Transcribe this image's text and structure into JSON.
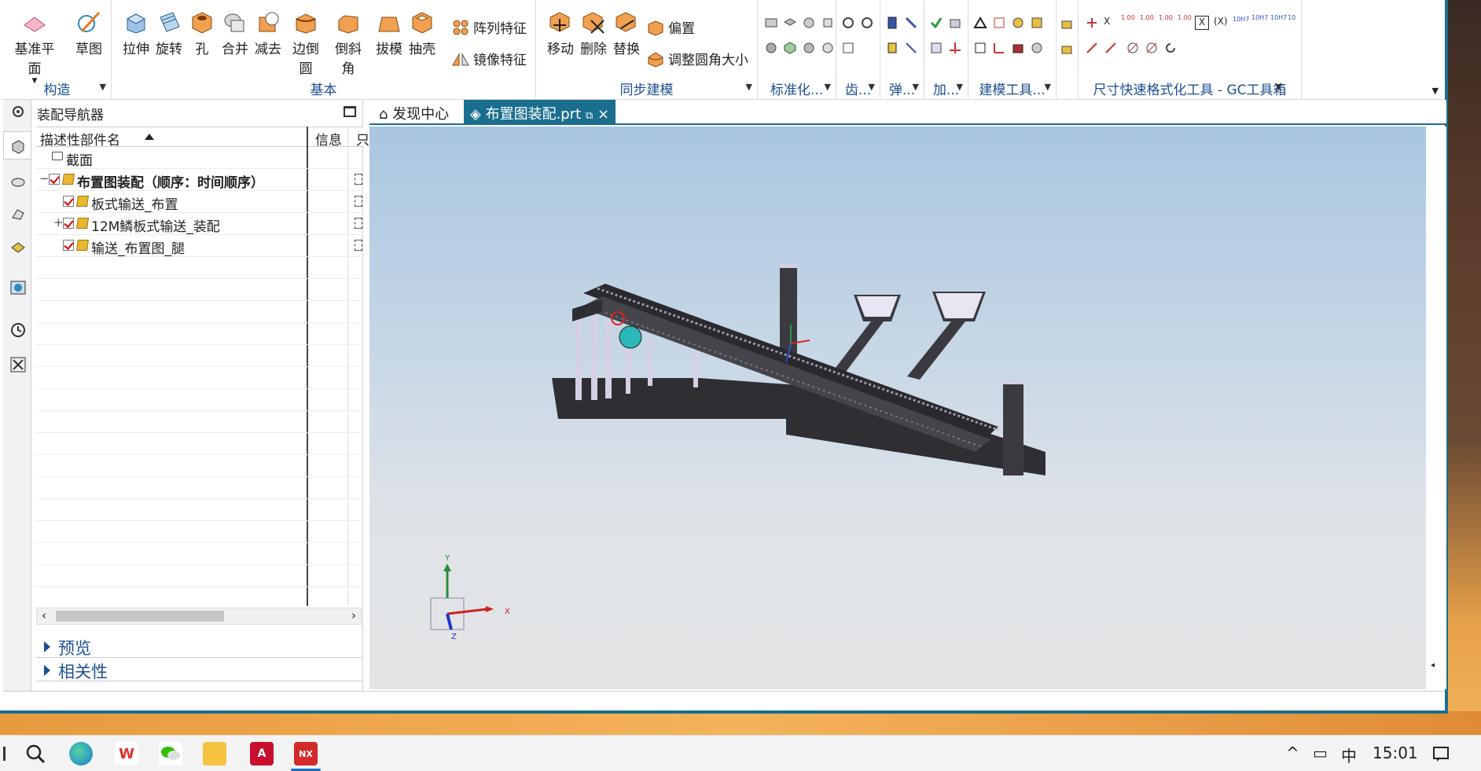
{
  "ribbon": {
    "groups": {
      "construct": "构造",
      "basic": "基本",
      "sync": "同步建模",
      "standard": "标准化...",
      "gear": "齿...",
      "spring": "弹...",
      "add": "加...",
      "modeling_tools": "建模工具...",
      "dim_format": "尺寸快速格式化工具 - GC工具箱"
    },
    "buttons": {
      "datum_plane": "基准平面",
      "sketch": "草图",
      "extrude": "拉伸",
      "revolve": "旋转",
      "hole": "孔",
      "unite": "合并",
      "subtract": "减去",
      "edge_blend": "边倒圆",
      "chamfer": "倒斜角",
      "draft": "拔模",
      "shell": "抽壳",
      "pattern_feature": "阵列特征",
      "mirror_feature": "镜像特征",
      "move": "移动",
      "delete": "删除",
      "replace": "替换",
      "offset": "偏置",
      "resize_blend": "调整圆角大小"
    },
    "dim_tags": [
      "X",
      "1.00",
      "1.00",
      "1.00",
      "1.00",
      "X",
      "(X)",
      "10H7",
      "10H7",
      "10H7",
      "10"
    ]
  },
  "navigator": {
    "title": "装配导航器",
    "columns": {
      "name": "描述性部件名",
      "info": "信息",
      "extra": "只"
    },
    "rows": [
      {
        "label": "截面",
        "bold": false,
        "level": 0,
        "type": "folder"
      },
      {
        "label": "布置图装配（顺序：时间顺序）",
        "bold": true,
        "level": 0,
        "type": "assembly"
      },
      {
        "label": "板式输送_布置",
        "bold": false,
        "level": 1,
        "type": "part"
      },
      {
        "label": "12M鳞板式输送_装配",
        "bold": false,
        "level": 1,
        "type": "assembly"
      },
      {
        "label": "输送_布置图_腿",
        "bold": false,
        "level": 1,
        "type": "part"
      }
    ],
    "panels": {
      "preview": "预览",
      "dependencies": "相关性"
    }
  },
  "tabs": [
    {
      "label": "发现中心",
      "active": false
    },
    {
      "label": "布置图装配.prt",
      "active": true
    }
  ],
  "viewport": {
    "axis_labels": {
      "x": "X",
      "y": "Y",
      "z": "Z"
    }
  },
  "taskbar": {
    "apps": [
      "search-icon",
      "edge-icon",
      "wps-icon",
      "wechat-icon",
      "file-explorer-icon",
      "autocad-icon",
      "nx-icon"
    ],
    "ime": "中",
    "time": "15:01"
  },
  "colors": {
    "accent": "#1a6e8e",
    "group_label": "#1d4f91",
    "model_dark": "#2f2f33",
    "model_light": "#d6d0e6"
  }
}
